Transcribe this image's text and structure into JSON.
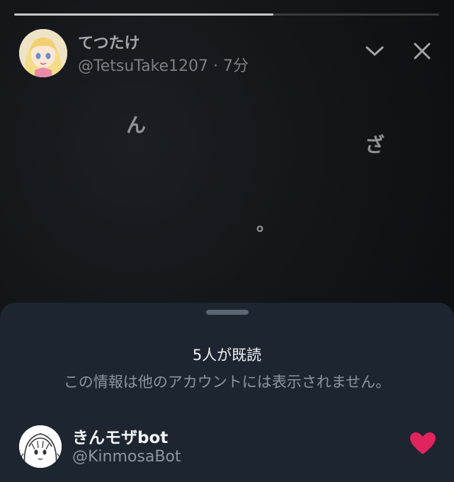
{
  "story": {
    "progress": 0.61,
    "author": {
      "display_name": "てつたけ",
      "handle": "@TetsuTake1207",
      "separator": " · ",
      "time_ago": "7分"
    },
    "text_fragments": [
      "ん",
      "ざ",
      "。"
    ],
    "icons": {
      "collapse": "chevron-down-icon",
      "close": "close-icon"
    }
  },
  "read_sheet": {
    "title": "5人が既読",
    "note": "この情報は他のアカウントには表示されません。",
    "viewers": [
      {
        "display_name": "きんモザbot",
        "handle": "@KinmosaBot",
        "reaction_icon": "heart-icon",
        "reaction_color": "#e0245e"
      }
    ]
  },
  "colors": {
    "background": "#111316",
    "sheet": "#1c2530",
    "progress_fill": "#c9cbce",
    "progress_track": "#3a3c40"
  }
}
